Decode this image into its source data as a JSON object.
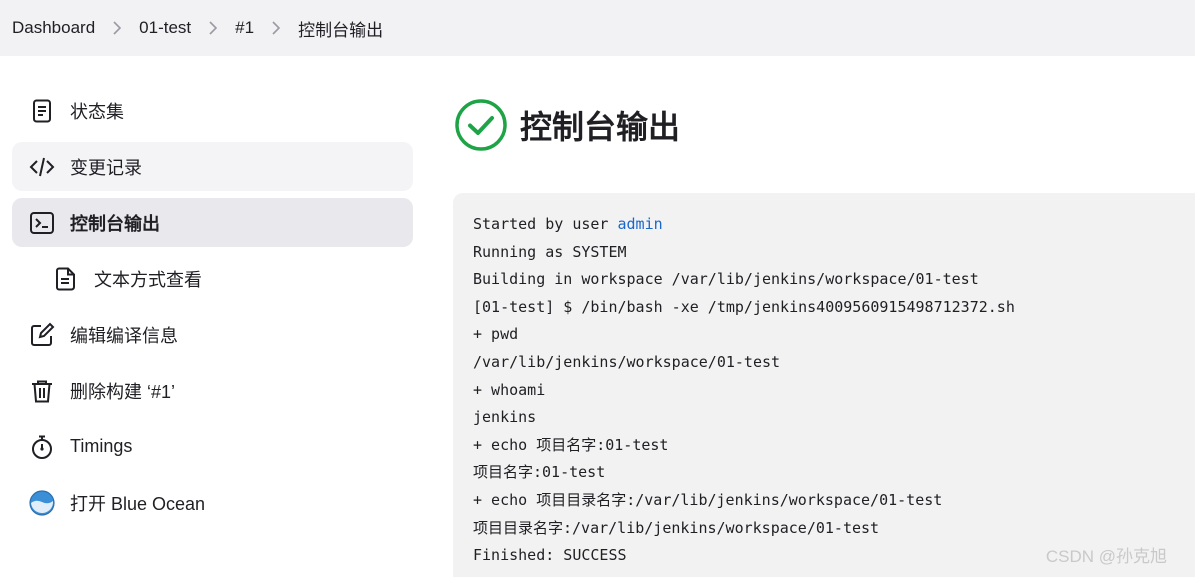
{
  "breadcrumb": [
    "Dashboard",
    "01-test",
    "#1",
    "控制台输出"
  ],
  "sidebar": {
    "items": [
      {
        "label": "状态集",
        "icon": "document-icon"
      },
      {
        "label": "变更记录",
        "icon": "code-icon"
      },
      {
        "label": "控制台输出",
        "icon": "terminal-icon"
      },
      {
        "label": "文本方式查看",
        "icon": "text-file-icon"
      },
      {
        "label": "编辑编译信息",
        "icon": "edit-icon"
      },
      {
        "label": "删除构建 ‘#1’",
        "icon": "trash-icon"
      },
      {
        "label": "Timings",
        "icon": "stopwatch-icon"
      },
      {
        "label": "打开 Blue Ocean",
        "icon": "blue-ocean-icon"
      }
    ]
  },
  "main": {
    "title": "控制台输出",
    "status_icon": "success-check-icon",
    "console": {
      "first_prefix": "Started by user ",
      "first_user": "admin",
      "lines": [
        "Running as SYSTEM",
        "Building in workspace /var/lib/jenkins/workspace/01-test",
        "[01-test] $ /bin/bash -xe /tmp/jenkins4009560915498712372.sh",
        "+ pwd",
        "/var/lib/jenkins/workspace/01-test",
        "+ whoami",
        "jenkins",
        "+ echo 项目名字:01-test",
        "项目名字:01-test",
        "+ echo 项目目录名字:/var/lib/jenkins/workspace/01-test",
        "项目目录名字:/var/lib/jenkins/workspace/01-test",
        "Finished: SUCCESS"
      ]
    }
  },
  "watermark": "CSDN @孙克旭",
  "colors": {
    "success": "#1ea446",
    "link": "#1a66cc",
    "active_bg": "#e8e8ed"
  }
}
